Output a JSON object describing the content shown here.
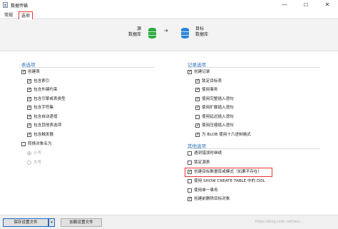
{
  "window": {
    "title": "数据传输",
    "minimize": "—",
    "maximize": "☐",
    "close": "✕"
  },
  "tabs": [
    {
      "label": "常规",
      "active": false
    },
    {
      "label": "选项",
      "active": true
    }
  ],
  "header": {
    "source_label": "源",
    "source_sub": "数据库",
    "target_label": "目标",
    "target_sub": "数据库",
    "arrow": "➔"
  },
  "table_options": {
    "title": "表选项",
    "create_table": {
      "label": "创建表",
      "checked": true
    },
    "items": [
      {
        "label": "包含索引",
        "checked": true
      },
      {
        "label": "包含外键约束",
        "checked": true
      },
      {
        "label": "包含引擎或表类型",
        "checked": true
      },
      {
        "label": "包含字符集",
        "checked": true
      },
      {
        "label": "包含自动递增",
        "checked": true
      },
      {
        "label": "包含其他表选项",
        "checked": true
      },
      {
        "label": "包含触发器",
        "checked": true
      }
    ],
    "convert_names": {
      "label": "转换对象名为",
      "checked": false
    },
    "case_options": [
      {
        "label": "小写",
        "selected": true
      },
      {
        "label": "大写",
        "selected": false
      }
    ]
  },
  "record_options": {
    "title": "记录选项",
    "create_records": {
      "label": "创建记录",
      "checked": true
    },
    "items": [
      {
        "label": "锁定目标表",
        "checked": true
      },
      {
        "label": "使用事务",
        "checked": true
      },
      {
        "label": "使用完整插入语句",
        "checked": true
      },
      {
        "label": "使用扩展插入语句",
        "checked": true
      },
      {
        "label": "使用延迟插入语句",
        "checked": false
      },
      {
        "label": "使用压缩插入语句",
        "checked": true
      },
      {
        "label": "为 BLOB 使用十六进制格式",
        "checked": true
      }
    ]
  },
  "other_options": {
    "title": "其他选项",
    "items": [
      {
        "label": "遇到错误时继续",
        "checked": false
      },
      {
        "label": "锁定源表",
        "checked": false
      },
      {
        "label": "创建目标数据库或模式（如果不存在）",
        "checked": true,
        "highlighted": true
      },
      {
        "label": "使用 SHOW CREATE TABLE 中的 DDL",
        "checked": false
      },
      {
        "label": "使用单一事务",
        "checked": false
      },
      {
        "label": "创建前删除目标对象",
        "checked": true
      }
    ]
  },
  "footer": {
    "save_settings": "保存设置文件",
    "dropdown": "▾",
    "load_settings": "加载设置文件"
  },
  "watermark": "https://blog.csdn.net/wei..."
}
